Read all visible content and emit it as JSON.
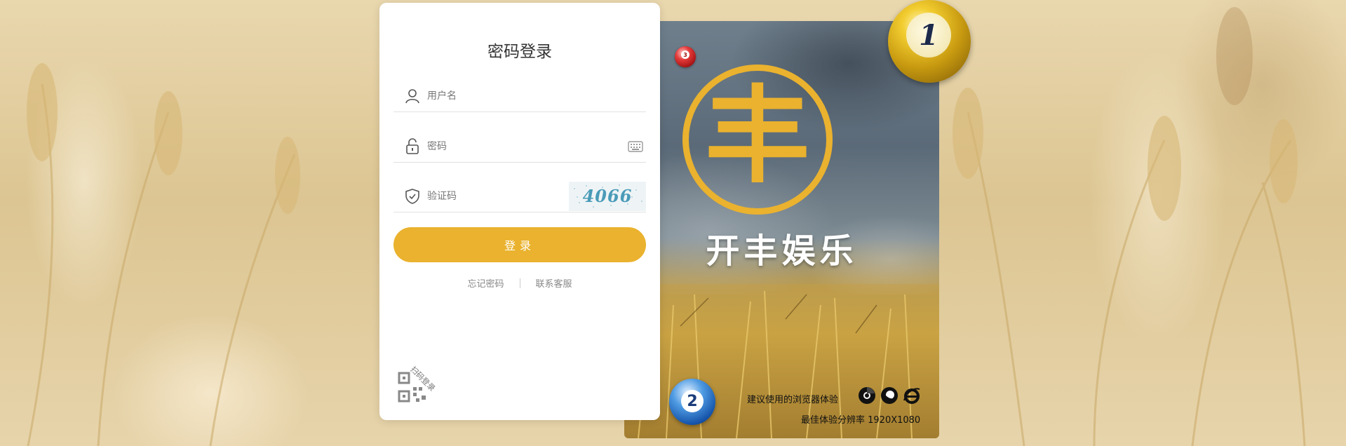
{
  "login": {
    "title": "密码登录",
    "username_placeholder": "用户名",
    "password_placeholder": "密码",
    "captcha_placeholder": "验证码",
    "captcha_code": "4066",
    "submit_label": "登录",
    "forgot_password": "忘记密码",
    "contact_support": "联系客服",
    "qr_login_label": "扫码登录"
  },
  "promo": {
    "logo_char": "丰",
    "brand_name": "开丰娱乐",
    "browser_tip": "建议使用的浏览器体验",
    "resolution_tip": "最佳体验分辨率 1920X1080",
    "browser_icons": [
      "chrome-icon",
      "firefox-icon",
      "ie-icon"
    ],
    "balls": {
      "gold": "1",
      "blue": "2",
      "red": "3"
    }
  },
  "colors": {
    "accent": "#eab22e",
    "card_bg": "#ffffff",
    "text": "#333333",
    "muted": "#888888"
  }
}
